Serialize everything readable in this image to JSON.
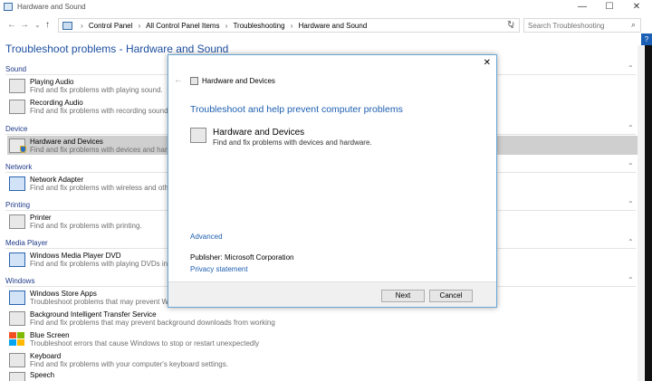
{
  "window": {
    "title": "Hardware and Sound",
    "controls": {
      "minimize": "—",
      "maximize": "☐",
      "close": "✕"
    }
  },
  "address": {
    "back": "←",
    "forward": "→",
    "recent": "⌄",
    "up": "↑",
    "separator": "›",
    "crumbs": [
      "Control Panel",
      "All Control Panel Items",
      "Troubleshooting",
      "Hardware and Sound"
    ],
    "dropdown": "⌄",
    "refresh": "↻",
    "search_placeholder": "Search Troubleshooting"
  },
  "page": {
    "title": "Troubleshoot problems - Hardware and Sound",
    "help": "?"
  },
  "categories": [
    {
      "label": "Sound",
      "items": [
        {
          "name": "Playing Audio",
          "desc": "Find and fix problems with playing sound."
        },
        {
          "name": "Recording Audio",
          "desc": "Find and fix problems with recording sound."
        }
      ]
    },
    {
      "label": "Device",
      "items": [
        {
          "name": "Hardware and Devices",
          "desc": "Find and fix problems with devices and hardw",
          "selected": true
        }
      ]
    },
    {
      "label": "Network",
      "items": [
        {
          "name": "Network Adapter",
          "desc": "Find and fix problems with wireless and othe"
        }
      ]
    },
    {
      "label": "Printing",
      "items": [
        {
          "name": "Printer",
          "desc": "Find and fix problems with printing."
        }
      ]
    },
    {
      "label": "Media Player",
      "items": [
        {
          "name": "Windows Media Player DVD",
          "desc": "Find and fix problems with playing DVDs in W"
        }
      ]
    },
    {
      "label": "Windows",
      "items": [
        {
          "name": "Windows Store Apps",
          "desc": "Troubleshoot problems that may prevent Wi"
        },
        {
          "name": "Background Intelligent Transfer Service",
          "desc": "Find and fix problems that may prevent background downloads from working"
        },
        {
          "name": "Blue Screen",
          "desc": "Troubleshoot errors that cause Windows to stop or restart unexpectedly"
        },
        {
          "name": "Keyboard",
          "desc": "Find and fix problems with your computer's keyboard settings."
        },
        {
          "name": "Speech",
          "desc": ""
        }
      ]
    }
  ],
  "dialog": {
    "close": "✕",
    "back": "←",
    "header": "Hardware and Devices",
    "title": "Troubleshoot and help prevent computer problems",
    "troubleshooter_name": "Hardware and Devices",
    "troubleshooter_desc": "Find and fix problems with devices and hardware.",
    "advanced": "Advanced",
    "publisher_label": "Publisher:",
    "publisher_value": "Microsoft Corporation",
    "privacy": "Privacy statement",
    "next": "Next",
    "cancel": "Cancel"
  }
}
